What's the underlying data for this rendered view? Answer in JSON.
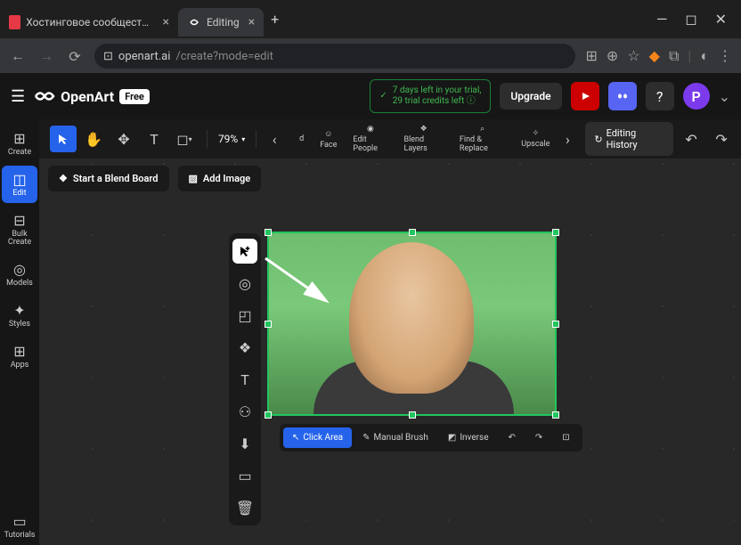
{
  "browser": {
    "tabs": [
      {
        "title": "Хостинговое сообщество «Tim",
        "favicon_color": "#e63946",
        "active": false
      },
      {
        "title": "Editing",
        "favicon_color": "#fff",
        "active": true
      }
    ],
    "url_host": "openart.ai",
    "url_path": "/create?mode=edit"
  },
  "header": {
    "brand": "OpenArt",
    "badge": "Free",
    "trial_line1": "7 days left in your trial,",
    "trial_line2": "29 trial credits left",
    "upgrade": "Upgrade",
    "avatar_letter": "P"
  },
  "left_rail": {
    "create": "Create",
    "edit": "Edit",
    "bulk": "Bulk Create",
    "models": "Models",
    "styles": "Styles",
    "apps": "Apps",
    "tutorials": "Tutorials"
  },
  "toolbar": {
    "zoom": "79%",
    "actions": {
      "d": "d",
      "face": "Face",
      "edit_people": "Edit People",
      "blend_layers": "Blend Layers",
      "find_replace": "Find & Replace",
      "upscale": "Upscale"
    },
    "history": "Editing History"
  },
  "canvas_buttons": {
    "blend_board": "Start a Blend Board",
    "add_image": "Add Image"
  },
  "bottom_bar": {
    "click_area": "Click Area",
    "manual_brush": "Manual Brush",
    "inverse": "Inverse"
  }
}
